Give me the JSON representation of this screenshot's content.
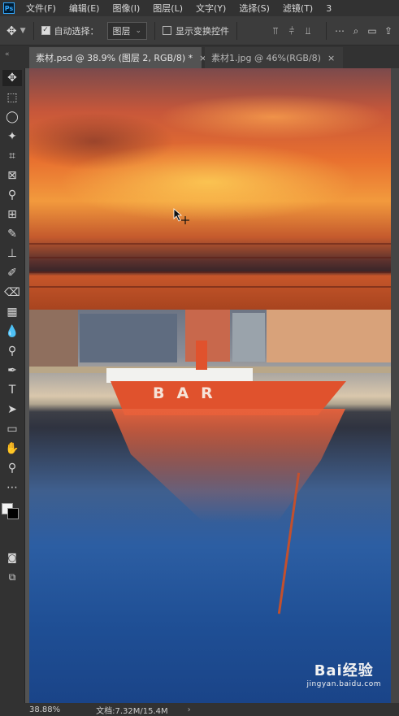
{
  "menu": {
    "items": [
      "文件(F)",
      "编辑(E)",
      "图像(I)",
      "图层(L)",
      "文字(Y)",
      "选择(S)",
      "滤镜(T)",
      "3"
    ],
    "logo": "Ps"
  },
  "options": {
    "auto_select_label": "自动选择：",
    "auto_select_checked": true,
    "layer_select_value": "图层",
    "show_transform_label": "显示变换控件",
    "show_transform_checked": false
  },
  "tabs": [
    {
      "label": "素材.psd @ 38.9% (图层 2, RGB/8) *",
      "active": true,
      "close": "×"
    },
    {
      "label": "素材1.jpg @ 46%(RGB/8)",
      "active": false,
      "close": "×"
    }
  ],
  "canvas": {
    "ship_lettering": "BAR"
  },
  "watermark": {
    "brand": "Bai经验",
    "url": "jingyan.baidu.com"
  },
  "status": {
    "zoom": "38.88%",
    "doc_info": "文档:7.32M/15.4M",
    "arrow": "›"
  },
  "colors": {
    "ui_dark": "#323232",
    "ui_mid": "#535353",
    "ps_blue": "#31a8ff"
  }
}
